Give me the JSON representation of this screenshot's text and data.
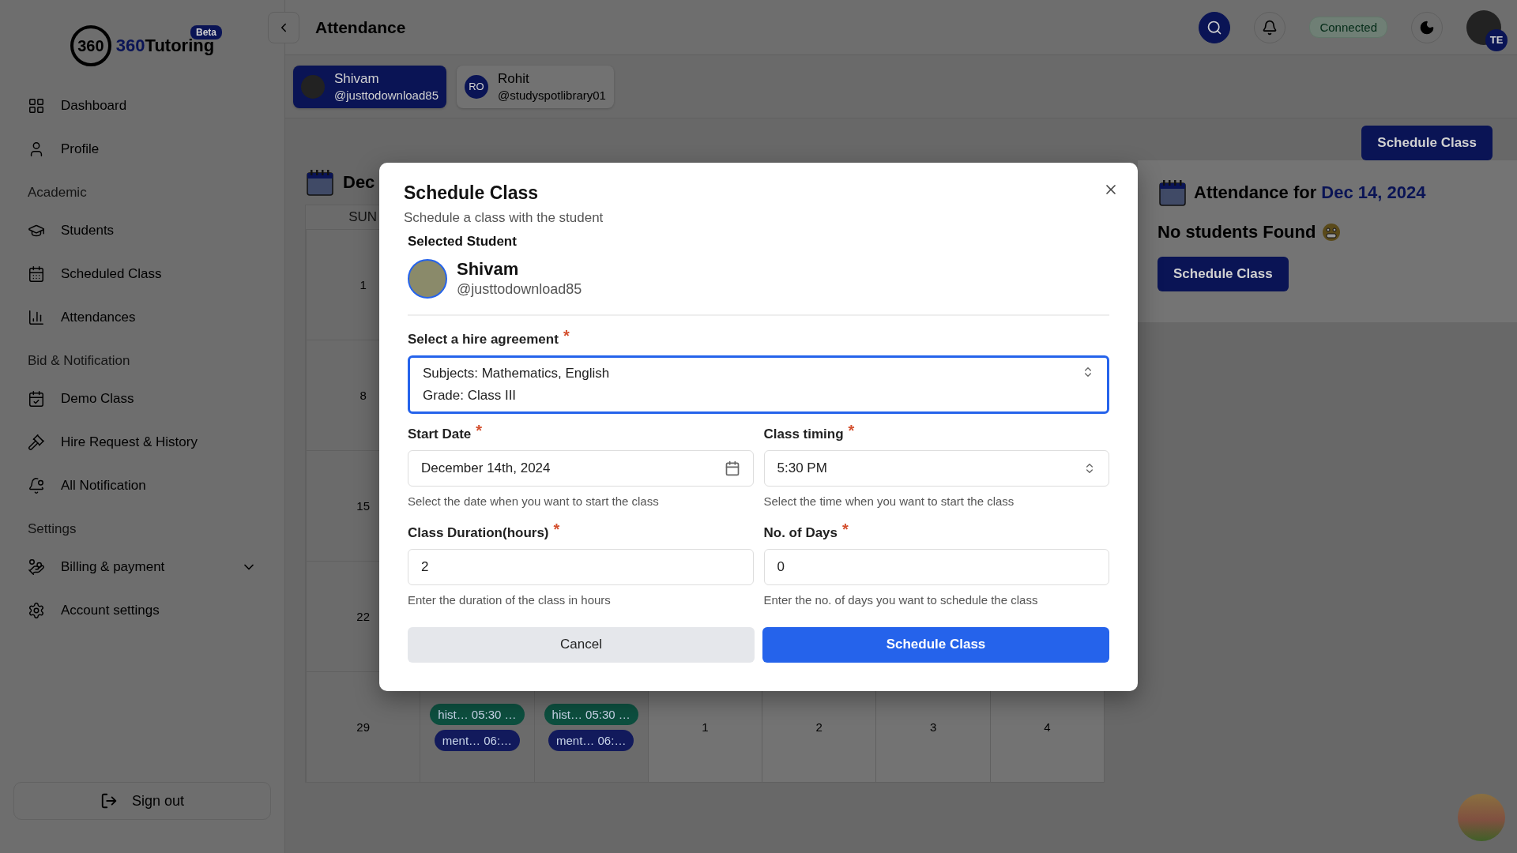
{
  "sidebar": {
    "logo": {
      "emblem": "360",
      "name_lead": "360",
      "name_rest": "Tutoring",
      "badge": "Beta"
    },
    "sections": [
      {
        "items": [
          {
            "label": "Dashboard",
            "expandable": false
          },
          {
            "label": "Profile",
            "expandable": false
          }
        ]
      },
      {
        "heading": "Academic",
        "items": [
          {
            "label": "Students",
            "expandable": false
          },
          {
            "label": "Scheduled Class",
            "expandable": false
          },
          {
            "label": "Attendances",
            "expandable": false
          }
        ]
      },
      {
        "heading": "Bid & Notification",
        "items": [
          {
            "label": "Demo Class",
            "expandable": false
          },
          {
            "label": "Hire Request & History",
            "expandable": false
          },
          {
            "label": "All Notification",
            "expandable": false
          }
        ]
      },
      {
        "heading": "Settings",
        "items": [
          {
            "label": "Billing & payment",
            "expandable": true
          },
          {
            "label": "Account settings",
            "expandable": false
          }
        ]
      }
    ],
    "sign_out": "Sign out"
  },
  "header": {
    "title": "Attendance",
    "status": "Connected",
    "avatar_badge": "TE"
  },
  "students": [
    {
      "name": "Shivam",
      "handle": "@justtodownload85",
      "selected": true
    },
    {
      "name": "Rohit",
      "handle": "@studyspotlibrary01",
      "initials": "RO",
      "selected": false
    }
  ],
  "schedule_button": "Schedule Class",
  "calendar": {
    "title": "Dec",
    "weekday": "SUN",
    "rows": [
      {
        "cells": [
          {
            "day": "1"
          },
          {},
          {},
          {},
          {},
          {},
          {}
        ]
      },
      {
        "cells": [
          {
            "day": "8"
          },
          {},
          {},
          {},
          {},
          {},
          {}
        ]
      },
      {
        "cells": [
          {
            "day": "15"
          },
          {},
          {},
          {},
          {},
          {},
          {}
        ]
      },
      {
        "cells": [
          {
            "day": "22"
          },
          {},
          {},
          {},
          {},
          {},
          {}
        ]
      },
      {
        "cells": [
          {
            "day": "29"
          },
          {
            "events": [
              {
                "text": "hist… 05:30 …",
                "color": "#0d4f3f"
              },
              {
                "text": "ment… 06:…",
                "color": "#121a5c"
              }
            ]
          },
          {
            "events": [
              {
                "text": "hist… 05:30 …",
                "color": "#0d4f3f"
              },
              {
                "text": "ment… 06:…",
                "color": "#121a5c"
              }
            ]
          },
          {
            "day": "1",
            "outside": true
          },
          {
            "day": "2",
            "outside": true
          },
          {
            "day": "3",
            "outside": true
          },
          {
            "day": "4",
            "outside": true
          }
        ]
      }
    ]
  },
  "attendance_panel": {
    "title": "Attendance for ",
    "date": "Dec 14, 2024",
    "empty": "No students Found",
    "button": "Schedule Class"
  },
  "modal": {
    "title": "Schedule Class",
    "subtitle": "Schedule a class with the student",
    "student_heading": "Selected Student",
    "student": {
      "name": "Shivam",
      "handle": "@justtodownload85"
    },
    "agreement": {
      "label": "Select a hire agreement",
      "required_mark": "*",
      "lines": [
        "Subjects: Mathematics, English",
        "Grade: Class III"
      ],
      "focused": true
    },
    "fields": [
      {
        "kind": "date",
        "label": "Start Date",
        "required_mark": "*",
        "value": "December 14th, 2024",
        "help": "Select the date when you want to start the class"
      },
      {
        "kind": "select",
        "label": "Class timing",
        "required_mark": "*",
        "value": "5:30 PM",
        "help": "Select the time when you want to start the class"
      },
      {
        "kind": "text",
        "label": "Class Duration(hours)",
        "required_mark": "*",
        "value": "2",
        "help": "Enter the duration of the class in hours"
      },
      {
        "kind": "text",
        "label": "No. of Days",
        "required_mark": "*",
        "value": "0",
        "help": "Enter the no. of days you want to schedule the class"
      }
    ],
    "cancel": "Cancel",
    "submit": "Schedule Class"
  }
}
